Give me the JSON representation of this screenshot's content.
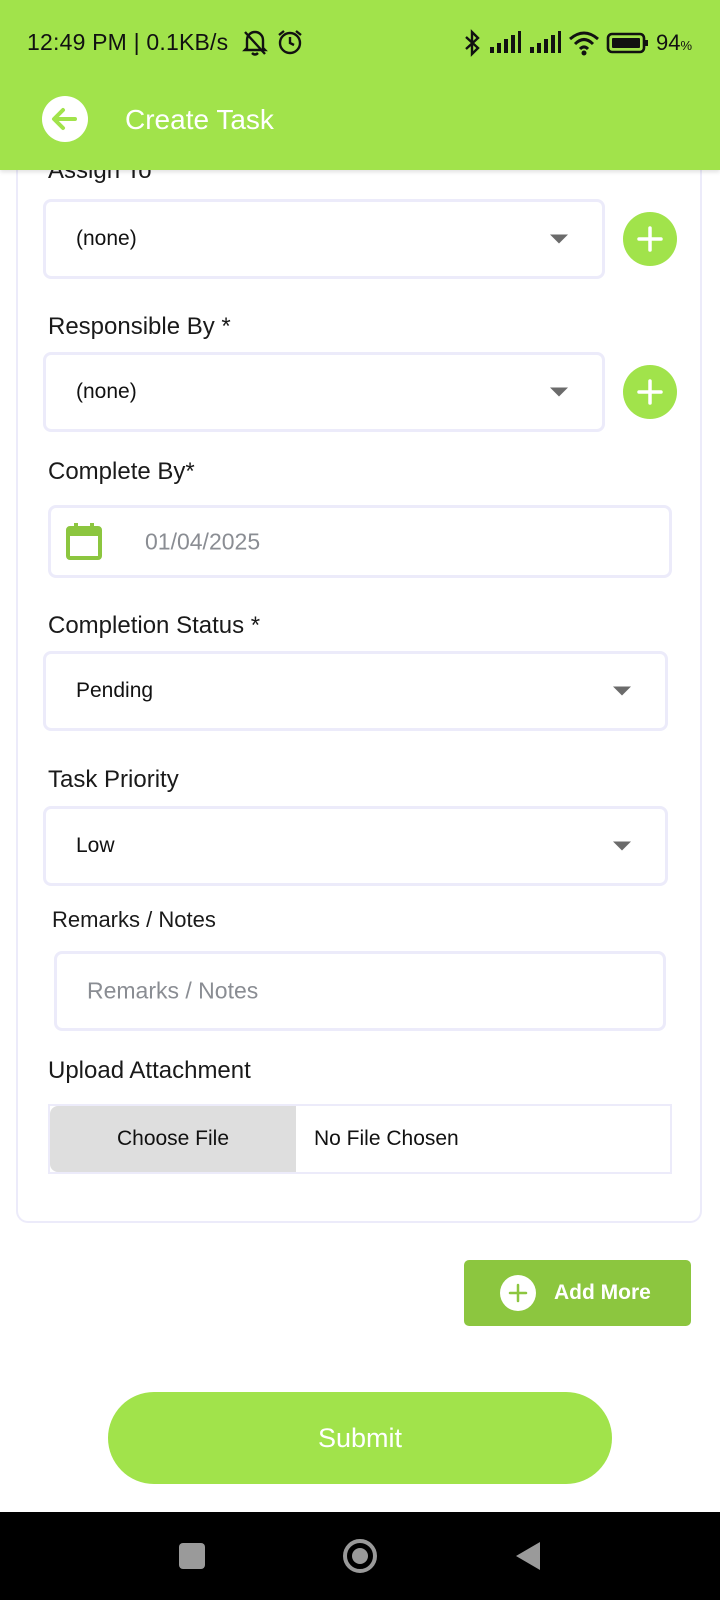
{
  "status_bar": {
    "time_speed": "12:49 PM | 0.1KB/s",
    "battery_percent": "94",
    "battery_unit": "%",
    "icons": [
      "mute-bell-icon",
      "alarm-icon",
      "bluetooth-icon",
      "signal-icon",
      "signal-icon",
      "wifi-icon",
      "battery-icon"
    ]
  },
  "app_bar": {
    "title": "Create Task",
    "back_icon": "arrow-left-icon"
  },
  "form": {
    "assign_to": {
      "label": "Assign To *",
      "value": "(none)"
    },
    "responsible_by": {
      "label": "Responsible By *",
      "value": "(none)"
    },
    "complete_by": {
      "label": "Complete By*",
      "value": "01/04/2025"
    },
    "completion_status": {
      "label": "Completion Status *",
      "value": "Pending"
    },
    "task_priority": {
      "label": "Task Priority",
      "value": "Low"
    },
    "remarks": {
      "label": "Remarks / Notes",
      "placeholder": "Remarks / Notes"
    },
    "upload": {
      "label": "Upload Attachment",
      "button": "Choose File",
      "file_name": "No File Chosen"
    }
  },
  "actions": {
    "add_more": "Add More",
    "submit": "Submit"
  },
  "colors": {
    "accent": "#a1e34b",
    "add_more": "#8cc63f",
    "field_border": "#ecebfa"
  }
}
